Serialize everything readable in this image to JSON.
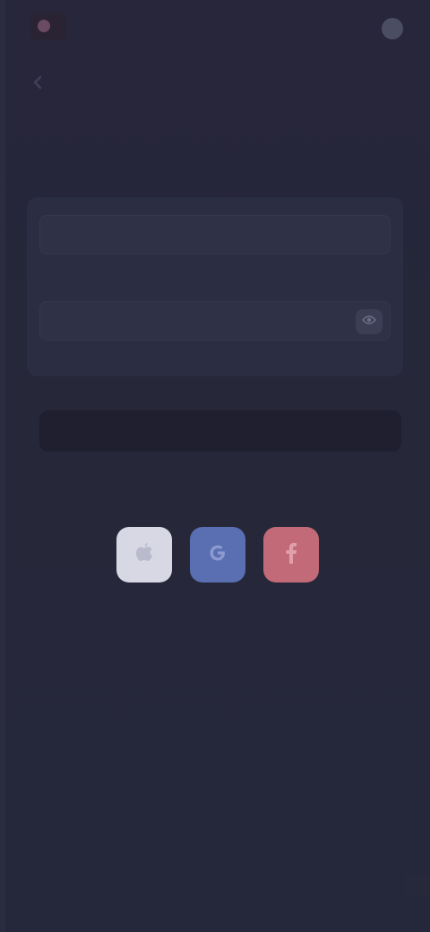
{
  "app": {
    "brand_label": "",
    "top_link": "",
    "top_button": ""
  },
  "page": {
    "heading": "",
    "subtext": "",
    "divider_text": "",
    "social_caption": ""
  },
  "form": {
    "email_label": "",
    "email_placeholder": "",
    "email_value": "",
    "password_label": "",
    "password_placeholder": "",
    "password_value": "",
    "submit_label": ""
  },
  "social": [
    {
      "name": "apple",
      "color": "#d7d8e4"
    },
    {
      "name": "google",
      "color": "#5a6fb2"
    },
    {
      "name": "facebook",
      "color": "#c26a78"
    }
  ],
  "footer": {
    "text": ""
  },
  "colors": {
    "background": "#262738",
    "card": "#2b2d42",
    "field": "#2f3147",
    "submit": "#1f1f2f"
  },
  "icons": {
    "brand": "brand-logo-icon",
    "back": "chevron-left-icon",
    "eye": "eye-icon",
    "apple": "apple-icon",
    "google": "google-icon",
    "facebook": "facebook-icon"
  }
}
